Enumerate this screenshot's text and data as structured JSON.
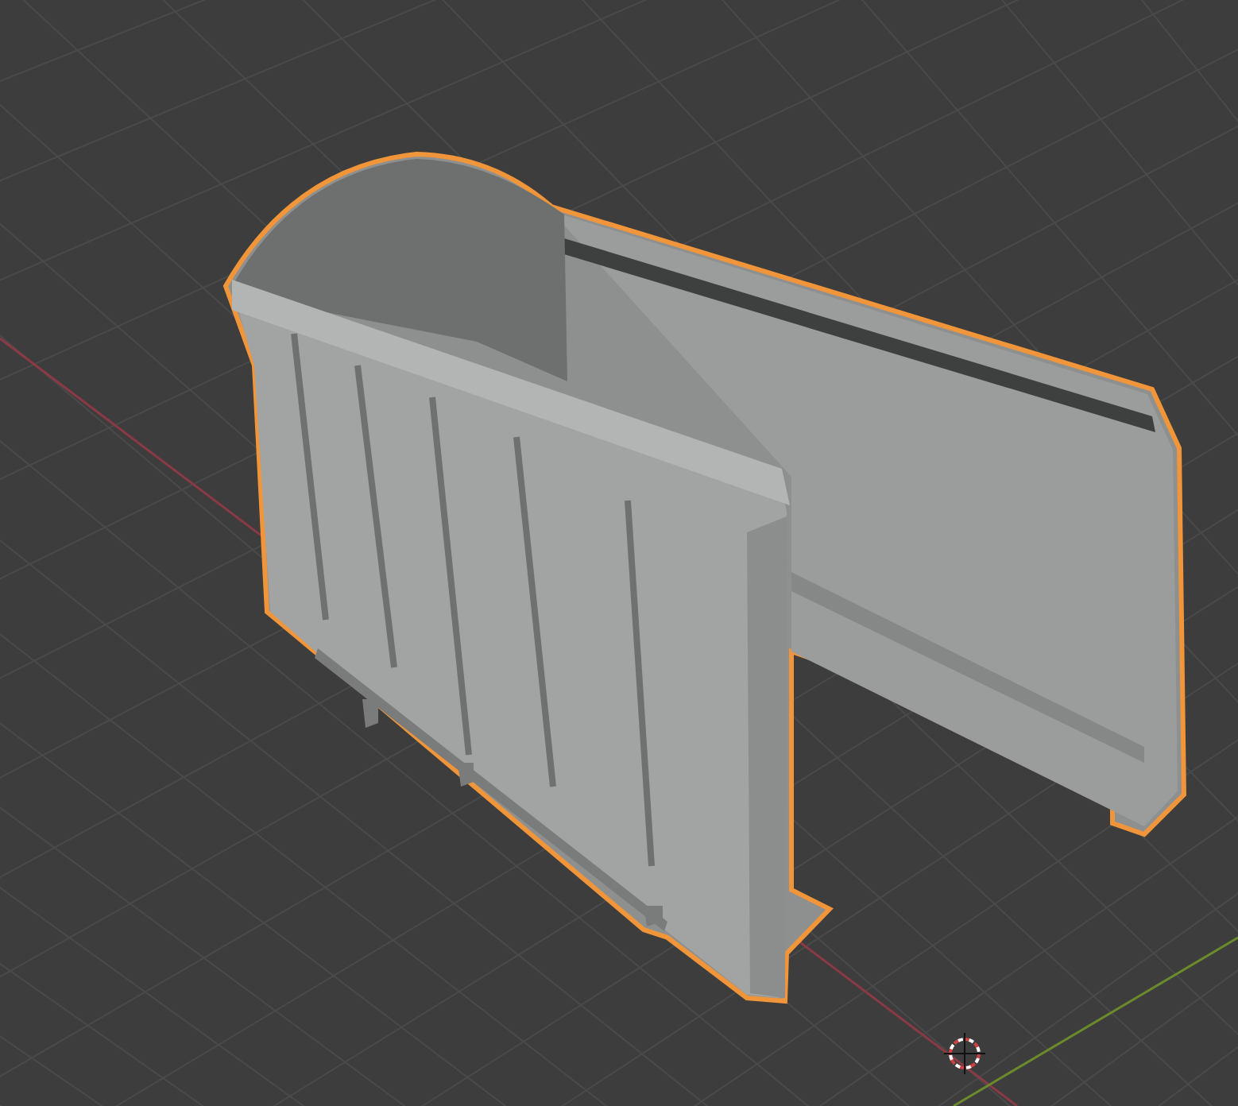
{
  "viewport": {
    "kind": "perspective",
    "object": {
      "selected": true
    }
  }
}
